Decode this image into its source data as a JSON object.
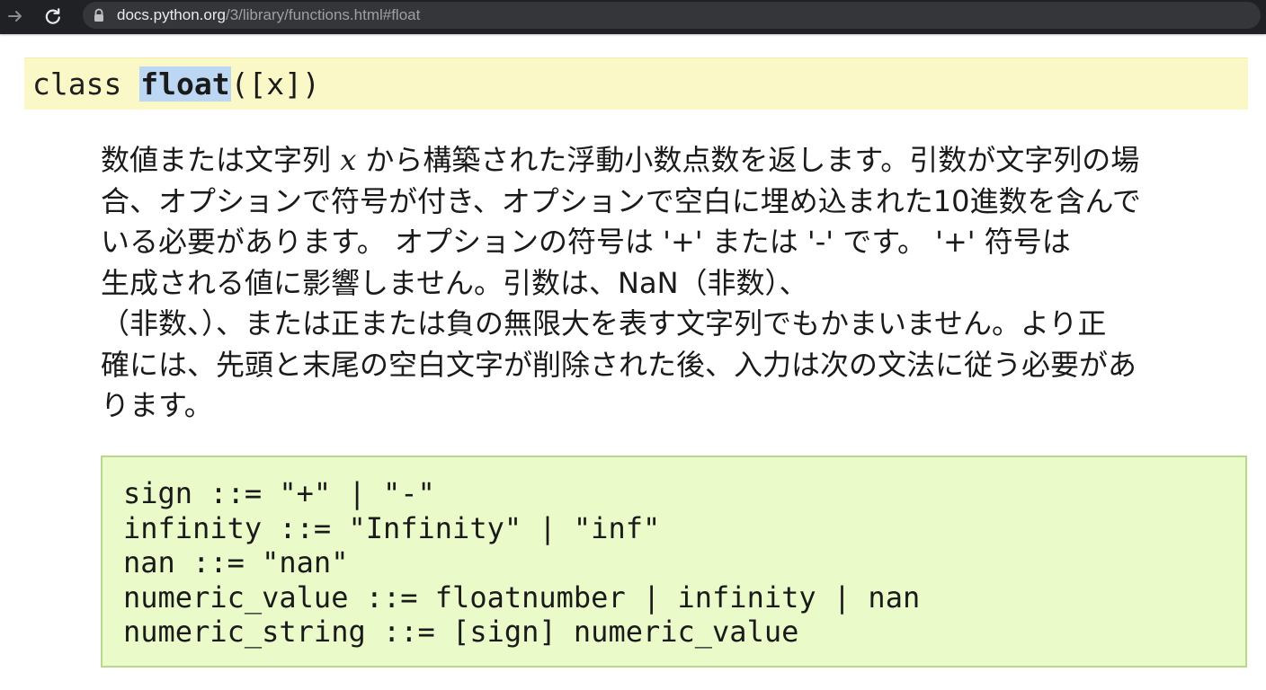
{
  "browser": {
    "url_host": "docs.python.org",
    "url_path": "/3/library/functions.html#float",
    "forward_icon": "arrow-right-icon",
    "reload_icon": "reload-icon",
    "lock_icon": "lock-icon"
  },
  "signature": {
    "keyword": "class",
    "name": "float",
    "params": "([x])"
  },
  "description": {
    "line1_before": "数値または文字列",
    "line1_var": "x",
    "line1_after": "から構築された浮動小数点数を返します。引数が文字列の場",
    "line2": "合、オプションで符号が付き、オプションで空白に埋め込まれた10進数を含んで",
    "line3": "いる必要があります。 オプションの符号は '+' または '-' です。 '+' 符号は",
    "line4": "生成される値に影響しません。引数は、NaN（非数）、",
    "line5": "（非数、）、または正または負の無限大を表す文字列でもかまいません。より正",
    "line6": "確には、先頭と末尾の空白文字が削除された後、入力は次の文法に従う必要があ",
    "line7": "ります。"
  },
  "grammar": [
    "sign ::= \"+\" | \"-\"",
    "infinity ::= \"Infinity\" | \"inf\"",
    "nan ::= \"nan\"",
    "numeric_value ::= floatnumber | infinity | nan",
    "numeric_string ::= [sign] numeric_value"
  ],
  "colors": {
    "topbar": "#202124",
    "signature_bg": "#fbf8c8",
    "name_highlight": "#bcd7f3",
    "code_bg": "#eafac9",
    "code_border": "#b8d98c"
  }
}
